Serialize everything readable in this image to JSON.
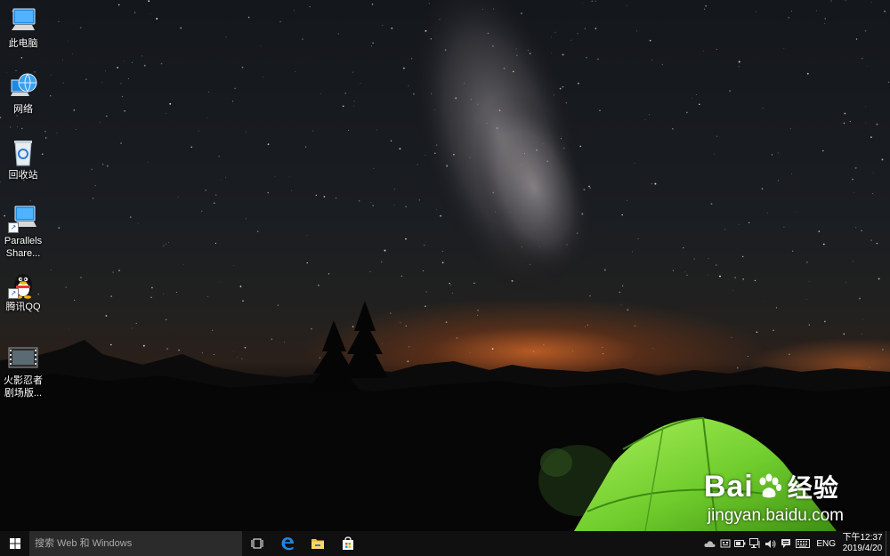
{
  "desktop": {
    "icons": [
      {
        "label": "此电脑"
      },
      {
        "label": "网络"
      },
      {
        "label": "回收站"
      },
      {
        "label": "Parallels Share..."
      },
      {
        "label": "腾讯QQ"
      },
      {
        "label": "火影忍者 剧场版..."
      }
    ]
  },
  "watermark": {
    "brand_left": "Bai",
    "brand_right": "经验",
    "url": "jingyan.baidu.com"
  },
  "taskbar": {
    "search_placeholder": "搜索 Web 和 Windows",
    "language": "ENG",
    "time": "下午12:37",
    "date": "2019/4/20"
  },
  "colors": {
    "taskbar_bg": "#101010",
    "search_bg": "#2b2b2b",
    "tent_green": "#7cd63a",
    "horizon_glow": "#e06a28"
  }
}
